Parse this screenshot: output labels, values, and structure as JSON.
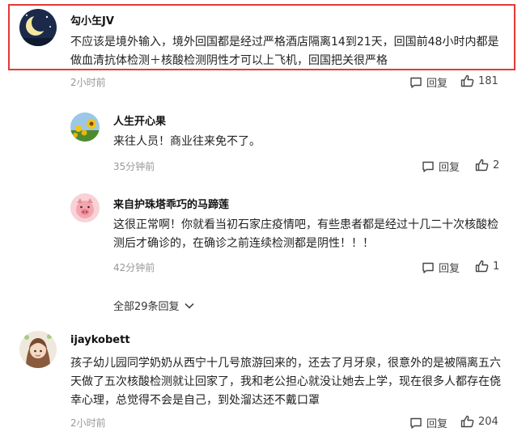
{
  "comments": [
    {
      "username": "勾小玍JV",
      "text_line1": "不应该是境外输入，境外回国都是经过严格酒店隔离14到21天，回国前48小时内都是",
      "text_line2": "做血清抗体检测＋核酸检测阴性才可以上飞机，回国把关很严格",
      "time": "2小时前",
      "reply_label": "回复",
      "likes": "181"
    },
    {
      "username": "人生开心果",
      "text_line1": "来往人员！商业往来免不了。",
      "time": "35分钟前",
      "reply_label": "回复",
      "likes": "2"
    },
    {
      "username": "来自护珠塔乖巧的马蹄莲",
      "text_line1": "这很正常啊！你就看当初石家庄疫情吧，有些患者都是经过十几二十次核酸检",
      "text_line2": "测后才确诊的，在确诊之前连续检测都是阴性！！！",
      "time": "42分钟前",
      "reply_label": "回复",
      "likes": "1"
    },
    {
      "username": "ijaykobett",
      "text_line1": "孩子幼儿园同学奶奶从西宁十几号旅游回来的，还去了月牙泉，很意外的是被隔离五六",
      "text_line2": "天做了五次核酸检测就让回家了，我和老公担心就没让她去上学，现在很多人都存在侥",
      "text_line3": "幸心理，总觉得不会是自己，到处溜达还不戴口罩",
      "time": "2小时前",
      "reply_label": "回复",
      "likes": "204"
    }
  ],
  "expand_replies": "全部29条回复",
  "colors": {
    "highlight": "#e53935",
    "meta": "#999999"
  },
  "icons": [
    "moon-avatar",
    "sunflower-avatar",
    "pig-avatar",
    "girl-avatar",
    "comment-icon",
    "thumbs-up-icon",
    "chevron-down-icon"
  ]
}
